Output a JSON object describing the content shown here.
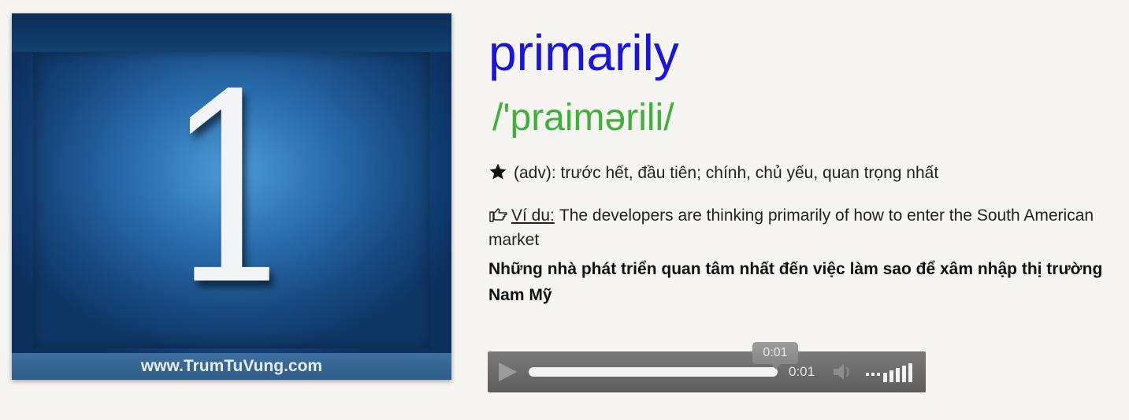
{
  "thumbnail": {
    "digit": "1",
    "site": "www.TrumTuVung.com"
  },
  "entry": {
    "word": "primarily",
    "ipa": "/'praimərili/",
    "definition": "(adv): trước hết, đầu tiên; chính, chủ yếu, quan trọng nhất",
    "example_label": "Ví du:",
    "example_text": "The developers are thinking primarily of how to enter the South American market",
    "translation": "Những nhà phát triển quan tâm nhất đến việc làm sao để xâm nhập thị trường Nam Mỹ"
  },
  "player": {
    "tooltip_time": "0:01",
    "current_time": "0:01",
    "progress_percent": 100,
    "volume_bars": 5,
    "icons": [
      "play-icon",
      "speaker-icon"
    ]
  },
  "colors": {
    "word": "#1a14e0",
    "ipa": "#3fb03a",
    "thumbnail_blue": "#2a6fae",
    "player_bg": "#666666"
  }
}
